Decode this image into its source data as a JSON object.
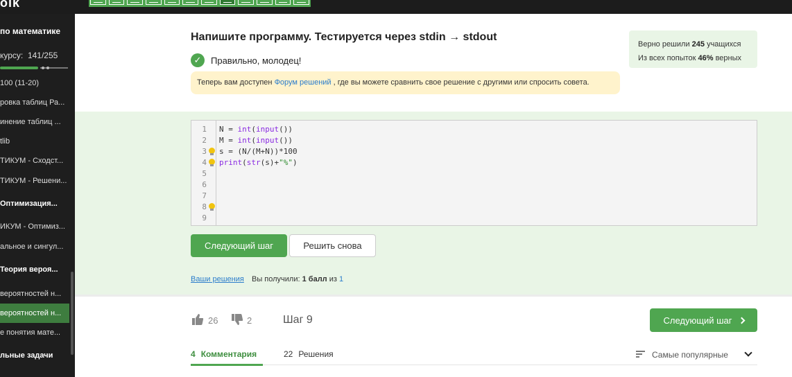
{
  "topbar": {
    "logo": "oik",
    "steps_count": 12,
    "active_step": 8
  },
  "sidebar": {
    "title": "по математике",
    "progress_label": "курсу:",
    "progress_value": "141/255",
    "progress_fraction": 0.553,
    "items": [
      {
        "label": "100 (11-20)",
        "bold": false,
        "active": false
      },
      {
        "label": "ровка таблиц Ра...",
        "bold": false,
        "active": false
      },
      {
        "label": "инение таблиц ...",
        "bold": false,
        "active": false
      },
      {
        "label": "tlib",
        "bold": false,
        "active": false
      },
      {
        "label": "ТИКУМ - Сходст...",
        "bold": false,
        "active": false
      },
      {
        "label": "ТИКУМ - Решени...",
        "bold": false,
        "active": false
      },
      {
        "label": "Оптимизация...",
        "bold": true,
        "active": false
      },
      {
        "label": "ИКУМ - Оптимиз...",
        "bold": false,
        "active": false
      },
      {
        "label": "альное и сингул...",
        "bold": false,
        "active": false
      },
      {
        "label": "Теория вероя...",
        "bold": true,
        "active": false
      },
      {
        "label": "вероятностей н...",
        "bold": false,
        "active": false
      },
      {
        "label": "вероятностей н...",
        "bold": false,
        "active": true
      },
      {
        "label": "е понятия мате...",
        "bold": false,
        "active": false
      },
      {
        "label": "льные задачи",
        "bold": true,
        "active": false
      }
    ]
  },
  "task": {
    "title": "Напишите программу. Тестируется через stdin → stdout",
    "status": "Правильно, молодец!",
    "notice_before": "Теперь вам доступен ",
    "notice_link": "Форум решений",
    "notice_after": " , где вы можете сравнить свое решение с другими или спросить совета."
  },
  "stats": {
    "line1_before": "Верно решили ",
    "line1_value": "245",
    "line1_after": " учащихся",
    "line2_before": "Из всех попыток ",
    "line2_value": "46%",
    "line2_after": " верных"
  },
  "editor": {
    "lines": [
      {
        "n": "1",
        "bulb": false
      },
      {
        "n": "2",
        "bulb": false
      },
      {
        "n": "3",
        "bulb": true
      },
      {
        "n": "4",
        "bulb": true
      },
      {
        "n": "5",
        "bulb": false
      },
      {
        "n": "6",
        "bulb": false
      },
      {
        "n": "7",
        "bulb": false
      },
      {
        "n": "8",
        "bulb": true
      },
      {
        "n": "9",
        "bulb": false
      }
    ],
    "code": [
      [
        "N = ",
        "int",
        "(",
        "input",
        "())"
      ],
      [
        "M = ",
        "int",
        "(",
        "input",
        "())"
      ],
      [
        "s = (N/(M+N))*100"
      ],
      [
        "print",
        "(",
        "str",
        "(s)+",
        "\"%\"",
        ")"
      ]
    ]
  },
  "actions": {
    "next_step": "Следующий шаг",
    "retry": "Решить снова",
    "your_solutions": "Ваши решения",
    "score_before": "Вы получили: ",
    "score_value": "1 балл",
    "score_mid": " из ",
    "score_max": "1"
  },
  "footer": {
    "likes": "26",
    "dislikes": "2",
    "step_label": "Шаг 9",
    "next_step": "Следующий шаг",
    "tab_comments_count": "4",
    "tab_comments": "Комментария",
    "tab_solutions_count": "22",
    "tab_solutions": "Решения",
    "sort_label": "Самые популярные"
  },
  "colors": {
    "accent": "#4fa650",
    "link": "#2a7ccb",
    "notice": "#fff3cc",
    "green_area": "#e9f5e6"
  }
}
